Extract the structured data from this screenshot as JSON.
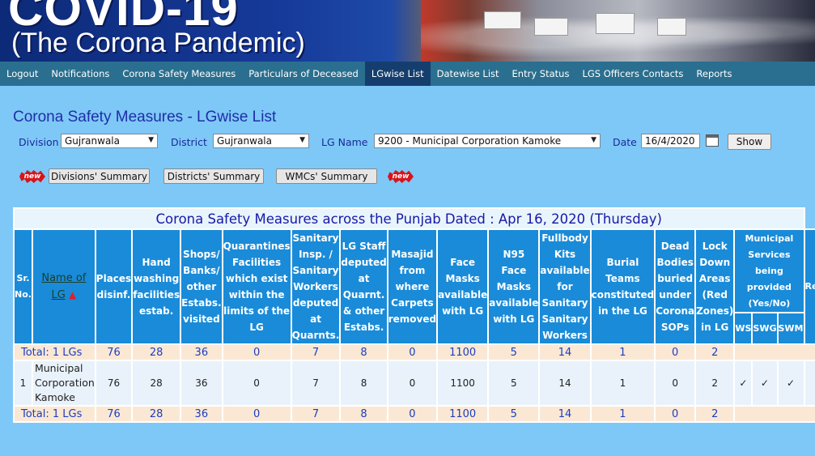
{
  "banner": {
    "title_line1": "COVID-19",
    "title_line2": "(The Corona Pandemic)"
  },
  "nav": {
    "items": [
      {
        "label": "Logout"
      },
      {
        "label": "Notifications"
      },
      {
        "label": "Corona Safety Measures"
      },
      {
        "label": "Particulars of Deceased"
      },
      {
        "label": "LGwise List"
      },
      {
        "label": "Datewise List"
      },
      {
        "label": "Entry Status"
      },
      {
        "label": "LGS Officers Contacts"
      },
      {
        "label": "Reports"
      }
    ],
    "active_index": 4
  },
  "page": {
    "title": "Corona Safety Measures - LGwise List"
  },
  "filters": {
    "division_label": "Division",
    "division_value": "Gujranwala",
    "district_label": "District",
    "district_value": "Gujranwala",
    "lg_label": "LG Name",
    "lg_value": "9200 - Municipal Corporation Kamoke",
    "date_label": "Date",
    "date_value": "16/4/2020",
    "show_label": "Show"
  },
  "summary": {
    "new_badge": "new",
    "divisions_label": "Divisions' Summary",
    "districts_label": "Districts' Summary",
    "wmcs_label": "WMCs' Summary"
  },
  "table": {
    "caption": "Corona Safety Measures across the Punjab Dated : Apr 16, 2020 (Thursday)",
    "headers": {
      "sr": "Sr. No.",
      "name": "Name of LG",
      "places": "Places disinf.",
      "hand": "Hand washing facilities estab.",
      "shops": "Shops/ Banks/ other Estabs. visited",
      "quarantine": "Quarantines Facilities which exist within the limits of the LG",
      "sanitary": "Sanitary Insp. / Sanitary Workers deputed at Quarnts.",
      "lgstaff": "LG Staff deputed at Quarnt. & other Estabs.",
      "masajid": "Masajid from where Carpets removed",
      "facemasks": "Face Masks available with LG",
      "n95": "N95 Face Masks available with LG",
      "fullbody": "Fullbody Kits available for Sanitary Sanitary Workers",
      "burial": "Burial Teams constituted in the LG",
      "dead": "Dead Bodies buried under Corona SOPs",
      "lockdown": "Lock Down Areas (Red Zones) in LG",
      "municipal": "Municipal Services being provided (Yes/No)",
      "ws": "WS",
      "swg": "SWG",
      "swm": "SWM",
      "remarks": "Remarks"
    },
    "total_row": {
      "label": "Total: 1 LGs",
      "places": "76",
      "hand": "28",
      "shops": "36",
      "quarantine": "0",
      "sanitary": "7",
      "lgstaff": "8",
      "masajid": "0",
      "facemasks": "1100",
      "n95": "5",
      "fullbody": "14",
      "burial": "1",
      "dead": "0",
      "lockdown": "2"
    },
    "rows": [
      {
        "sr": "1",
        "name": "Municipal Corporation Kamoke",
        "places": "76",
        "hand": "28",
        "shops": "36",
        "quarantine": "0",
        "sanitary": "7",
        "lgstaff": "8",
        "masajid": "0",
        "facemasks": "1100",
        "n95": "5",
        "fullbody": "14",
        "burial": "1",
        "dead": "0",
        "lockdown": "2",
        "ws": "✓",
        "swg": "✓",
        "swm": "✓",
        "remarks": ""
      }
    ]
  },
  "colors": {
    "page_bg": "#7ec8f7",
    "nav_bg": "#2a6f8f",
    "nav_active": "#153e6e",
    "header_bg": "#1a8bd8",
    "total_bg": "#fbe8d4",
    "row_bg": "#e9f2fb",
    "title_color": "#1f2ea8"
  }
}
